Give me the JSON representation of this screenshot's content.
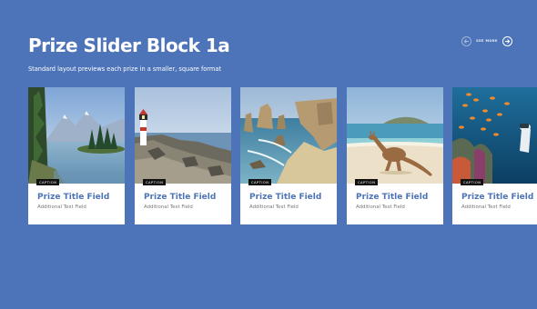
{
  "header": {
    "title": "Prize Slider Block 1a",
    "subtitle": "Standard layout previews each prize in a smaller, square format"
  },
  "nav": {
    "prev_icon": "arrow-left-icon",
    "label": "SEE MORE",
    "next_icon": "arrow-right-icon"
  },
  "cards": [
    {
      "image": "lake-mountains-trees",
      "caption": "CAPTION",
      "title": "Prize Title Field",
      "text": "Additional Text Field"
    },
    {
      "image": "lighthouse-rocky-coast",
      "caption": "CAPTION",
      "title": "Prize Title Field",
      "text": "Additional Text Field"
    },
    {
      "image": "sea-stacks-beach",
      "caption": "CAPTION",
      "title": "Prize Title Field",
      "text": "Additional Text Field"
    },
    {
      "image": "kangaroo-beach",
      "caption": "CAPTION",
      "title": "Prize Title Field",
      "text": "Additional Text Field"
    },
    {
      "image": "coral-reef-fish-diver",
      "caption": "CAPTION",
      "title": "Prize Title Field",
      "text": "Additional Text Field"
    }
  ],
  "colors": {
    "background": "#4d74b8",
    "card": "#ffffff",
    "accent_title": "#4d74b8",
    "caption_bg": "#111111"
  }
}
